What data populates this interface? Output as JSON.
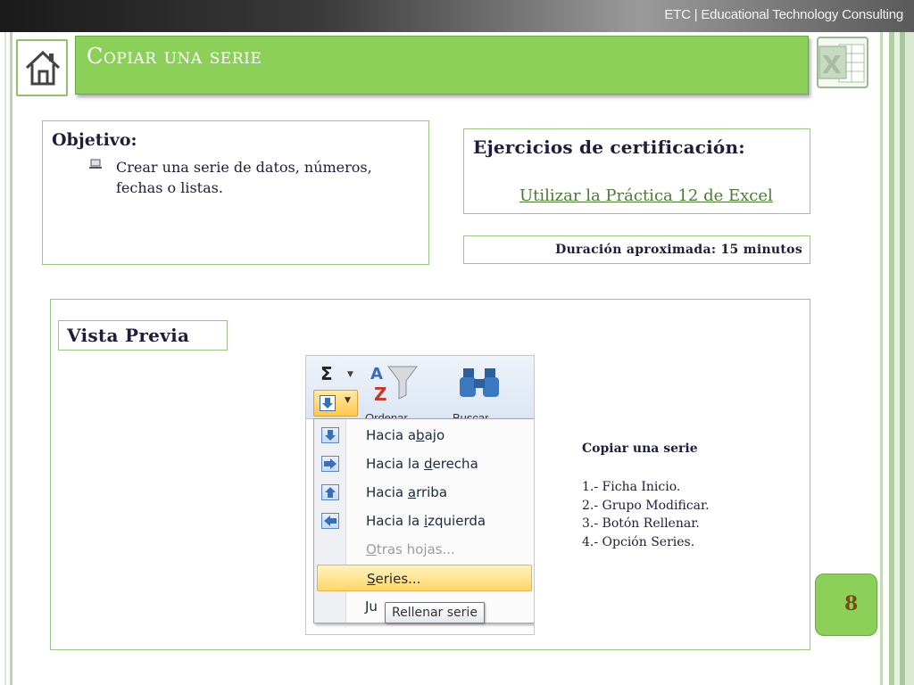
{
  "header": {
    "brand": "ETC | Educational Technology Consulting",
    "title": "Copiar una serie"
  },
  "objective": {
    "title": "Objetivo:",
    "text": "Crear una serie de datos, números, fechas o listas."
  },
  "certification": {
    "title": "Ejercicios de  certificación:",
    "link": "Utilizar la Práctica 12 de Excel"
  },
  "duration": {
    "text": "Duración aproximada:   15 minutos"
  },
  "preview": {
    "label": "Vista Previa",
    "ribbon": {
      "sort_label": "Ordenar",
      "find_label": "Buscar"
    },
    "menu": {
      "items": [
        {
          "pre": "Hacia a",
          "u": "b",
          "post": "ajo",
          "icon": "arrow-down-icon"
        },
        {
          "pre": "Hacia la ",
          "u": "d",
          "post": "erecha",
          "icon": "arrow-right-icon"
        },
        {
          "pre": "Hacia ",
          "u": "a",
          "post": "rriba",
          "icon": "arrow-up-icon"
        },
        {
          "pre": "Hacia la ",
          "u": "i",
          "post": "zquierda",
          "icon": "arrow-left-icon"
        },
        {
          "pre": "",
          "u": "O",
          "post": "tras hojas...",
          "icon": ""
        },
        {
          "pre": "",
          "u": "S",
          "post": "eries...",
          "icon": ""
        }
      ],
      "partial": "Ju",
      "tooltip": "Rellenar serie"
    }
  },
  "instructions": {
    "title": "Copiar una serie",
    "steps": [
      "1.- Ficha Inicio.",
      "2.- Grupo Modificar.",
      "3.- Botón Rellenar.",
      "4.- Opción Series."
    ]
  },
  "page_number": "8",
  "colors": {
    "accent_green": "#8cd05a",
    "border_green": "#9ac582",
    "text_dark": "#1e1e3a",
    "link_green": "#4c7a34"
  }
}
